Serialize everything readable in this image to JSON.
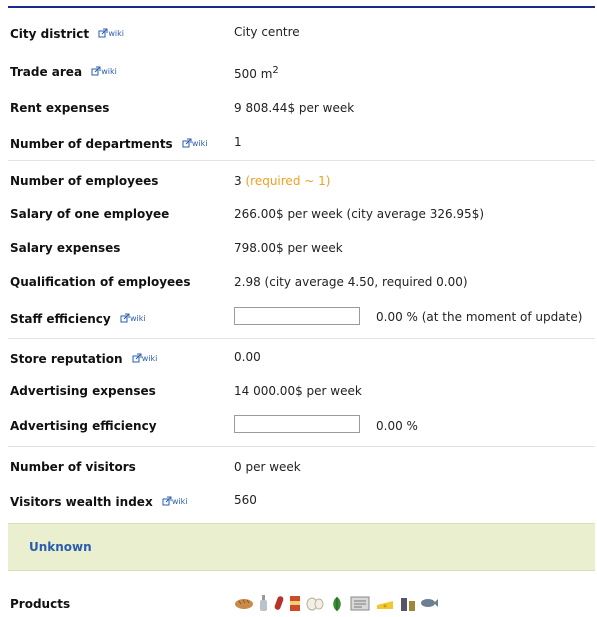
{
  "wiki_label": "wiki",
  "rows": {
    "city_district": {
      "label": "City district",
      "value": "City centre"
    },
    "trade_area": {
      "label": "Trade area",
      "value": "500 m",
      "sup": "2"
    },
    "rent_expenses": {
      "label": "Rent expenses",
      "value": "9 808.44$ per week"
    },
    "departments": {
      "label": "Number of departments",
      "value": "1"
    },
    "employees": {
      "label": "Number of employees",
      "value": "3",
      "note": "(required ~ 1)"
    },
    "salary_one": {
      "label": "Salary of one employee",
      "value": "266.00$ per week (city average 326.95$)"
    },
    "salary_expenses": {
      "label": "Salary expenses",
      "value": "798.00$ per week"
    },
    "qualification": {
      "label": "Qualification of employees",
      "value": "2.98 (city average 4.50, required 0.00)"
    },
    "staff_efficiency": {
      "label": "Staff efficiency",
      "value": "0.00 % (at the moment of update)"
    },
    "store_reputation": {
      "label": "Store reputation",
      "value": "0.00"
    },
    "advertising_expenses": {
      "label": "Advertising expenses",
      "value": "14 000.00$ per week"
    },
    "advertising_efficiency": {
      "label": "Advertising efficiency",
      "value": "0.00 %"
    },
    "visitors": {
      "label": "Number of visitors",
      "value": "0 per week"
    },
    "wealth_index": {
      "label": "Visitors wealth index",
      "value": "560"
    }
  },
  "banner": {
    "text": "Unknown"
  },
  "products": {
    "label": "Products",
    "icons": [
      "bread-icon",
      "bottle-icon",
      "sausage-icon",
      "can-icon",
      "egg-icon",
      "vegetables-icon",
      "newspaper-icon",
      "cheese-icon",
      "drinks-icon",
      "fish-icon"
    ]
  },
  "colors": {
    "accent": "#2a5db0",
    "warning": "#f0a020",
    "banner_bg": "#e9efcf",
    "top_rule": "#1b2a8a"
  }
}
